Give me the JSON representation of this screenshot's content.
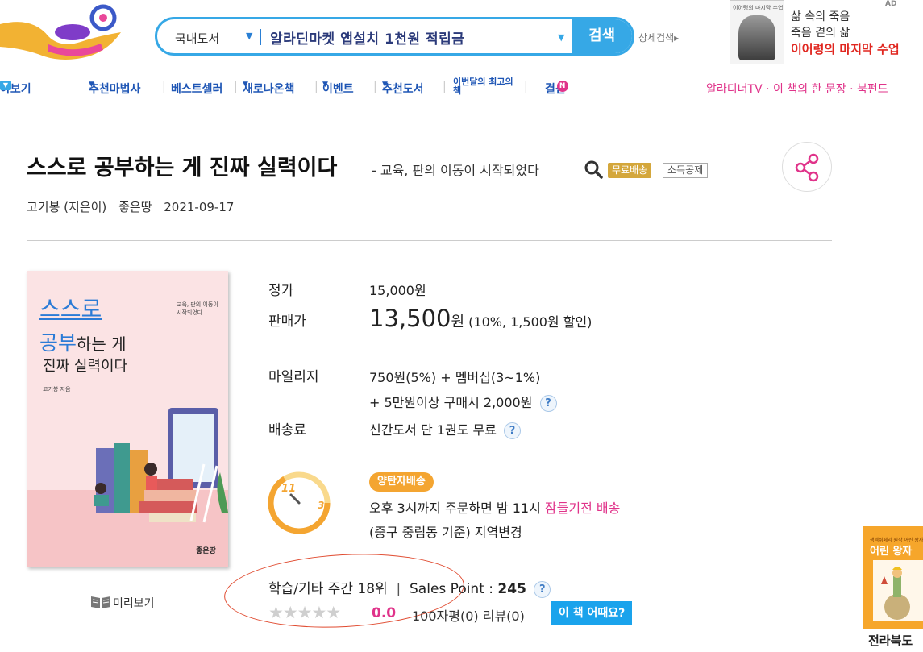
{
  "header": {
    "search": {
      "category": "국내도서",
      "query": "알라딘마켓 앱설치 1천원 적립금",
      "button_label": "검색",
      "advanced_label": "상세검색"
    },
    "ad": {
      "thumb_text": "이어령의 마지막 수업",
      "line1": "삶 속의 죽음",
      "line2": "죽음 곁의 삶",
      "line3": "이어령의 마지막 수업",
      "badge": "AD"
    }
  },
  "nav": {
    "items": [
      "야보기",
      "추천마법사",
      "베스트셀러",
      "새로나온책",
      "이벤트",
      "추천도서",
      "이번달의 최고의 책",
      "결산"
    ],
    "n_badge": "N",
    "right_links": "알라디너TV · 이 책의 한 문장 · 북펀드"
  },
  "book": {
    "title": "스스로 공부하는 게 진짜 실력이다",
    "subtitle": "- 교육, 판의 이동이 시작되었다",
    "badge_free": "무료배송",
    "badge_tax": "소득공제",
    "author": "고기봉 (지은이)",
    "publisher": "좋은땅",
    "date": "2021-09-17",
    "cover": {
      "line1": "스스로",
      "line2_big": "공부",
      "line2_rest": "하는 게",
      "line3": "진짜 실력이다",
      "subtitle": "교육, 판의 이동이 시작되었다",
      "author": "고기봉 지음",
      "publisher": "좋은땅"
    },
    "preview_label": "미리보기"
  },
  "price": {
    "list_label": "정가",
    "list_value": "15,000원",
    "sale_label": "판매가",
    "sale_value": "13,500",
    "sale_unit": "원",
    "sale_note": "(10%, 1,500원 할인)",
    "mileage_label": "마일리지",
    "mileage_line1": "750원(5%) + 멤버십(3~1%)",
    "mileage_line2": "+ 5만원이상 구매시 2,000원",
    "shipping_label": "배송료",
    "shipping_value": "신간도서 단 1권도 무료",
    "qmark": "?"
  },
  "delivery": {
    "badge": "양탄자배송",
    "clock_11": "11",
    "clock_3": "3",
    "line1_prefix": "오후 3시까지 주문하면 밤 11시",
    "line1_highlight": "잠들기전 배송",
    "line2": "(중구 중림동 기준) 지역변경"
  },
  "ranking": {
    "weekly": "학습/기타 주간 18위",
    "sep": "|",
    "sales_label": "Sales Point :",
    "sales_value": "245"
  },
  "rating": {
    "stars": "★★★★★",
    "score": "0.0",
    "reviews": "100자평(0)   리뷰(0)",
    "button": "이 책 어때요?"
  },
  "side_banner": {
    "small": "생텍쥐페리 원작 어린 왕자",
    "title": "어린 왕자",
    "caption": "전라북도"
  },
  "colors": {
    "accent": "#36a8e6",
    "nav_blue": "#1f56b5",
    "pink": "#e0338a",
    "gold": "#d4a73c",
    "orange": "#f4a531",
    "annotation": "#e04a2f"
  }
}
